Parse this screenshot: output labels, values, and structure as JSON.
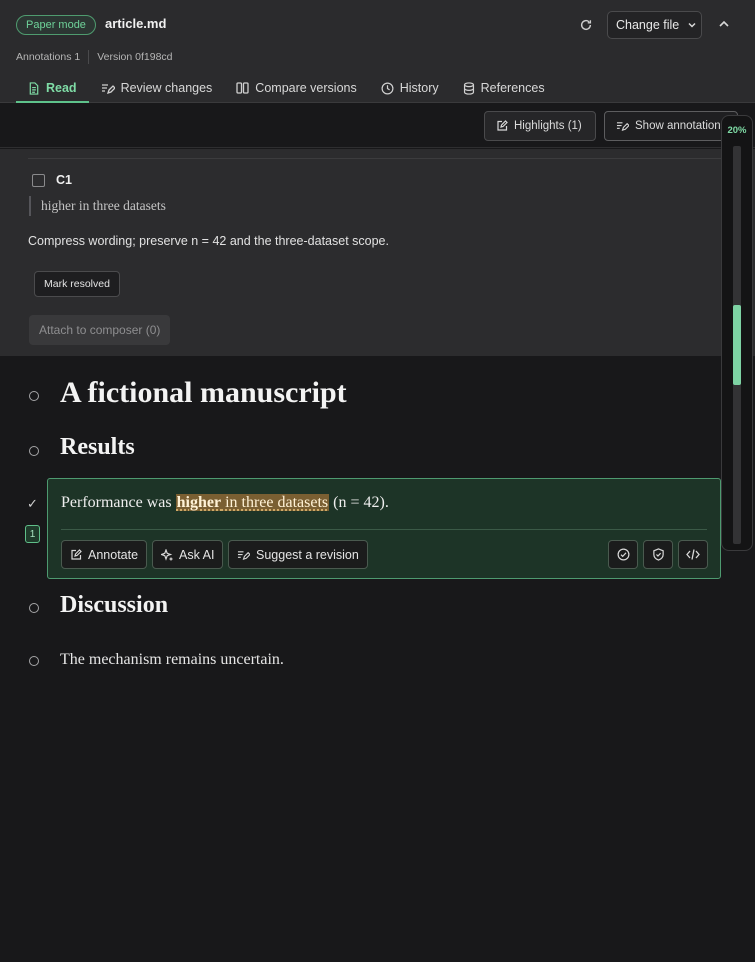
{
  "header": {
    "mode_badge": "Paper mode",
    "file_name": "article.md",
    "change_file_label": "Change file",
    "annotations_label": "Annotations 1",
    "version_label": "Version 0f198cd",
    "tabs": [
      {
        "label": "Read",
        "icon": "document-icon",
        "active": true
      },
      {
        "label": "Review changes",
        "icon": "edit-lines-icon",
        "active": false
      },
      {
        "label": "Compare versions",
        "icon": "columns-icon",
        "active": false
      },
      {
        "label": "History",
        "icon": "clock-icon",
        "active": false
      },
      {
        "label": "References",
        "icon": "database-icon",
        "active": false
      }
    ]
  },
  "toolbar": {
    "highlights_label": "Highlights (1)",
    "show_annotations_label": "Show annotations"
  },
  "annotation": {
    "id": "C1",
    "quote": "higher in three datasets",
    "note": "Compress wording; preserve n = 42 and the three-dataset scope.",
    "mark_resolved_label": "Mark resolved",
    "attach_label": "Attach to composer (0)"
  },
  "document": {
    "title": "A fictional manuscript",
    "results_heading": "Results",
    "results_para": {
      "before": "Performance was ",
      "highlight_bold": "higher",
      "highlight_rest": " in three datasets",
      "after": " (n = 42)."
    },
    "results_annotation_count": "1",
    "discussion_heading": "Discussion",
    "discussion_para": "The mechanism remains uncertain."
  },
  "actions": {
    "annotate_label": "Annotate",
    "ask_ai_label": "Ask AI",
    "suggest_label": "Suggest a revision"
  },
  "progress": {
    "label": "20%",
    "position": 0.4,
    "window": 0.2
  },
  "colors": {
    "accent": "#5ec28b",
    "highlight": "#7a5f32",
    "selected_bg": "#1d3427"
  }
}
